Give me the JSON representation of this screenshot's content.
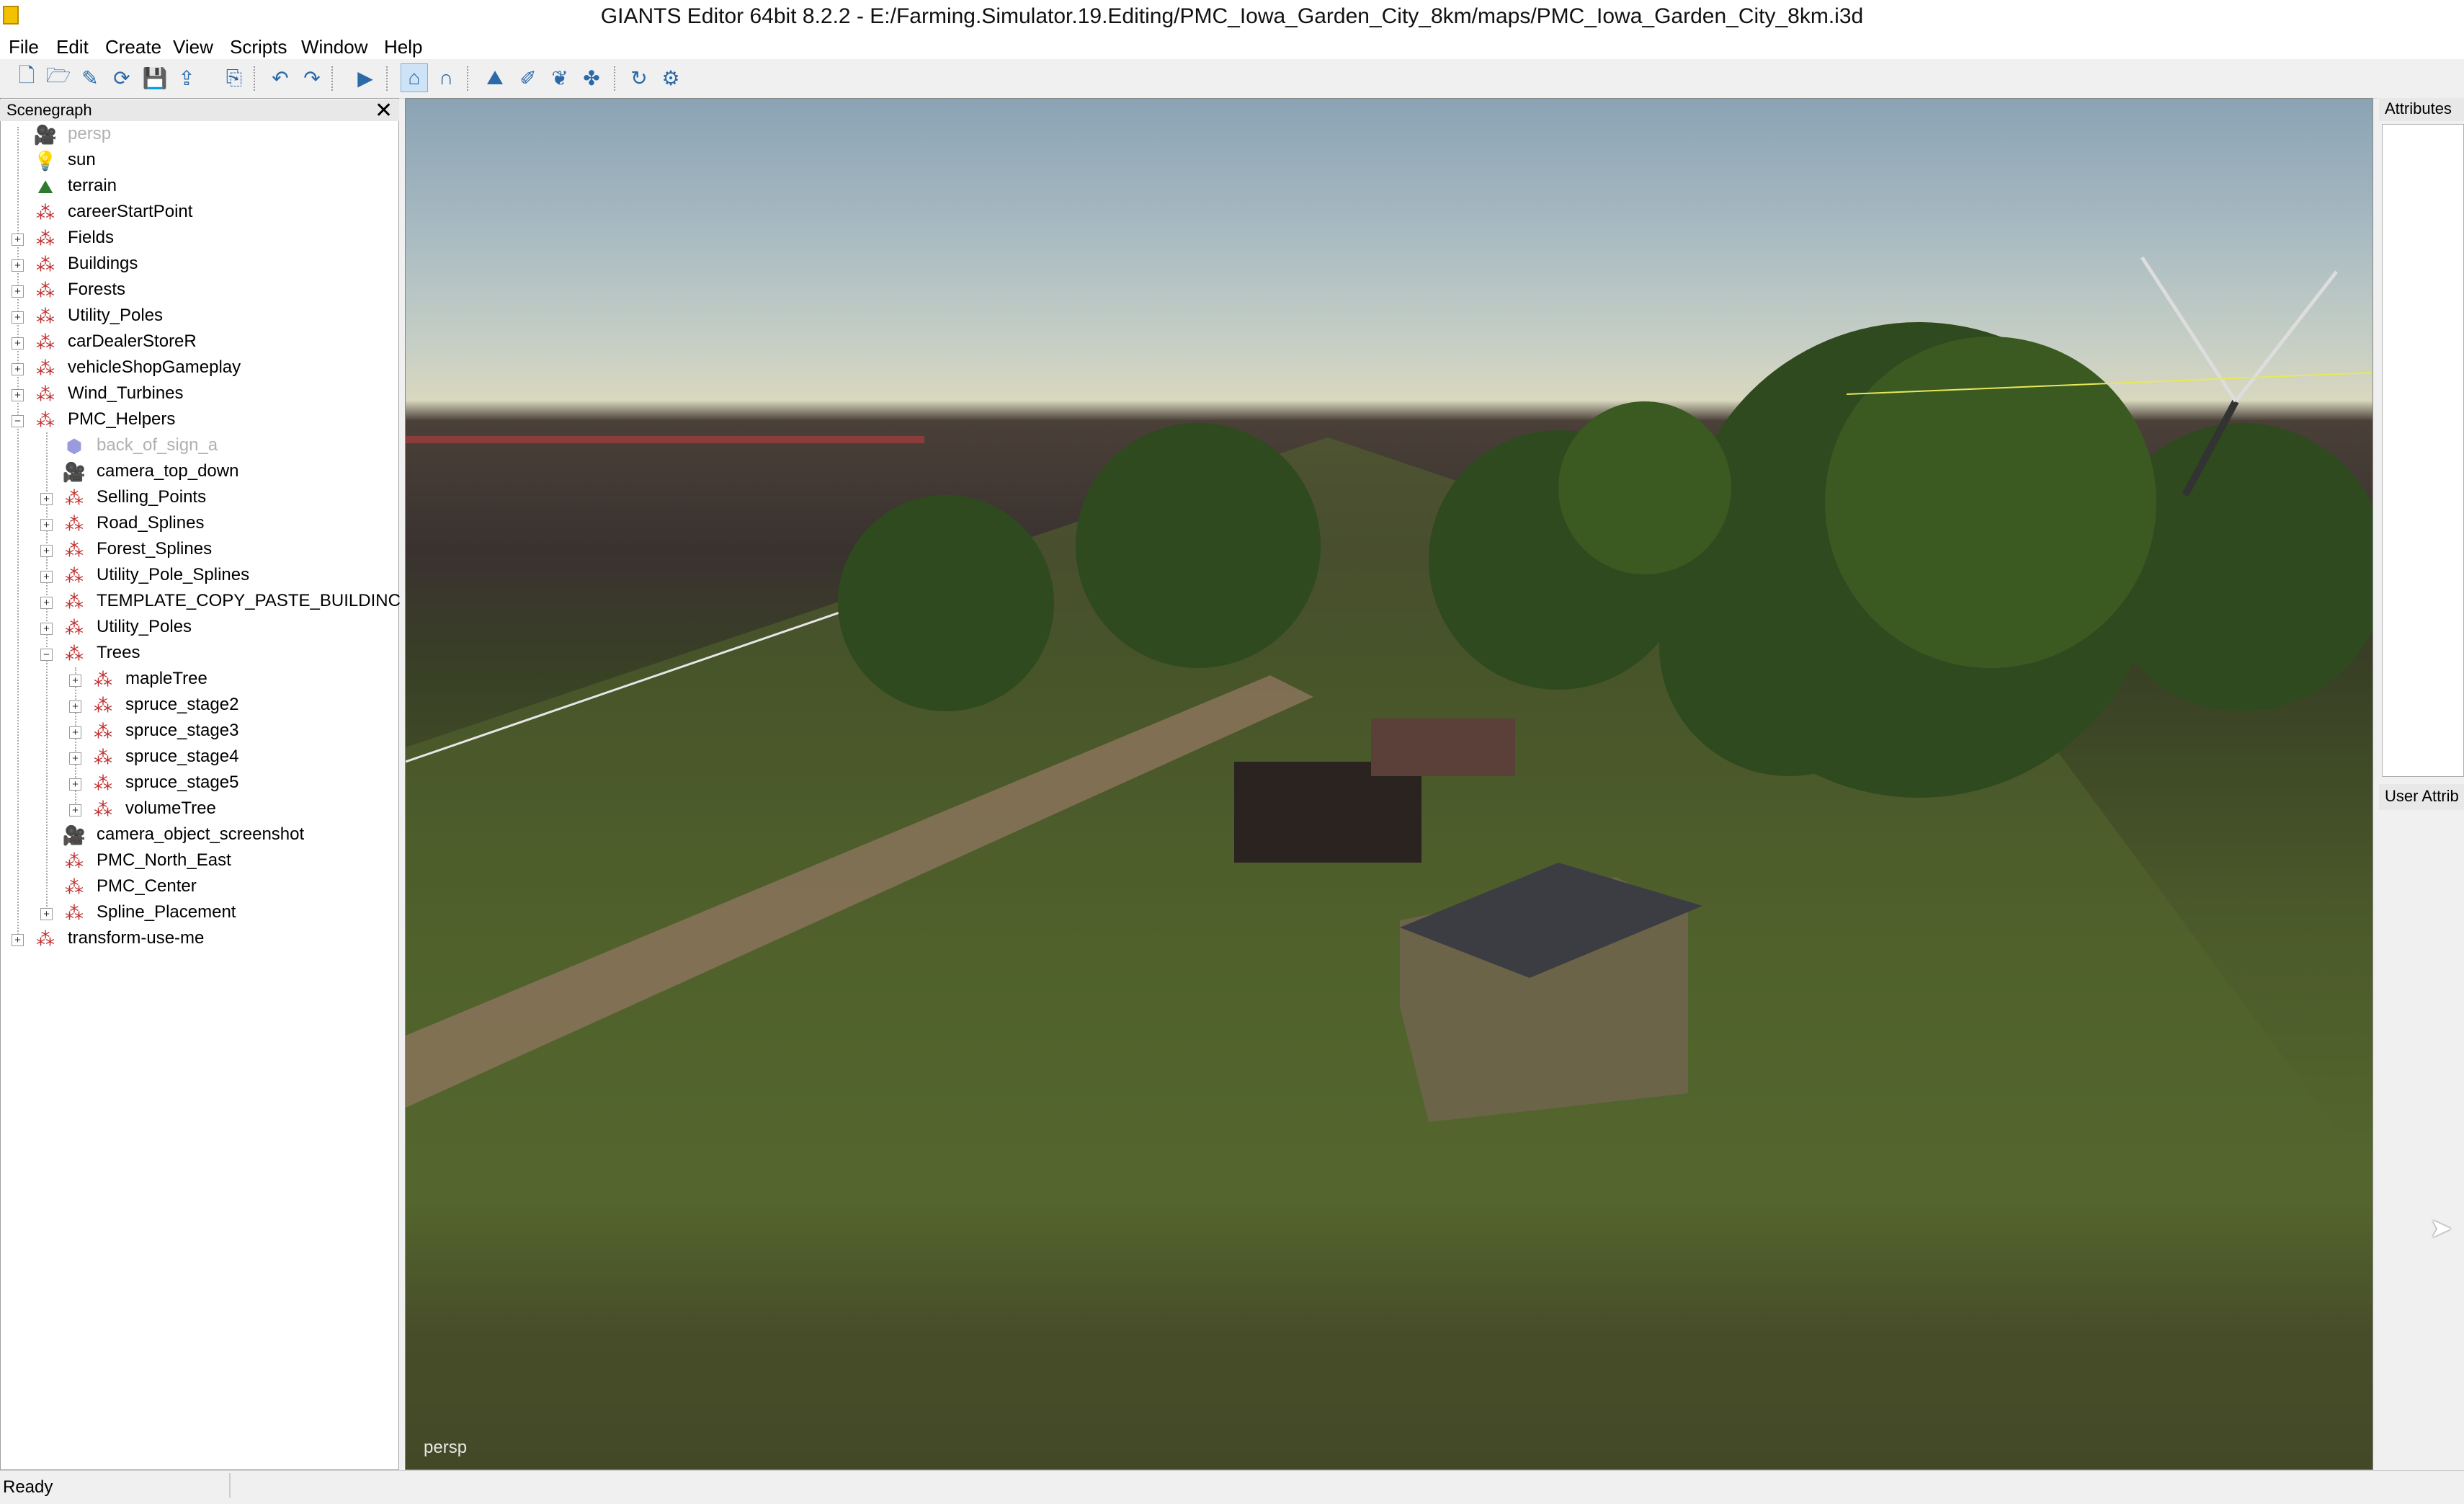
{
  "window": {
    "title": "GIANTS Editor 64bit 8.2.2 - E:/Farming.Simulator.19.Editing/PMC_Iowa_Garden_City_8km/maps/PMC_Iowa_Garden_City_8km.i3d"
  },
  "menu": [
    "File",
    "Edit",
    "Create",
    "View",
    "Scripts",
    "Window",
    "Help"
  ],
  "toolbar": [
    {
      "name": "new-icon",
      "glyph": "🗋"
    },
    {
      "name": "open-icon",
      "glyph": "🗁"
    },
    {
      "name": "edit-icon",
      "glyph": "✎"
    },
    {
      "name": "refresh-icon",
      "glyph": "⟳"
    },
    {
      "name": "save-icon",
      "glyph": "💾"
    },
    {
      "name": "export-icon",
      "glyph": "⇪"
    },
    {
      "name": "import-icon",
      "glyph": "⎘"
    },
    {
      "name": "undo-icon",
      "glyph": "↶"
    },
    {
      "name": "redo-icon",
      "glyph": "↷"
    },
    {
      "name": "play-icon",
      "glyph": "▶"
    },
    {
      "name": "select-mode-icon",
      "glyph": "⌂"
    },
    {
      "name": "move-mode-icon",
      "glyph": "∩"
    },
    {
      "name": "terrain-sculpt-icon",
      "glyph": "⛰"
    },
    {
      "name": "terrain-paint-icon",
      "glyph": "✐"
    },
    {
      "name": "foliage-paint-icon",
      "glyph": "❦"
    },
    {
      "name": "placement-icon",
      "glyph": "✤"
    },
    {
      "name": "rotate-icon",
      "glyph": "↻"
    },
    {
      "name": "settings-icon",
      "glyph": "⚙"
    }
  ],
  "scenegraph": {
    "title": "Scenegraph",
    "close": "✕",
    "nodes": [
      {
        "label": "persp",
        "icon": "camera-icon",
        "glyph": "🎥",
        "depth": 0,
        "exp": "",
        "dim": true
      },
      {
        "label": "sun",
        "icon": "light-icon",
        "glyph": "💡",
        "depth": 0,
        "exp": ""
      },
      {
        "label": "terrain",
        "icon": "terrain-icon",
        "glyph": "⛰",
        "depth": 0,
        "exp": ""
      },
      {
        "label": "careerStartPoint",
        "icon": "transform-icon",
        "glyph": "⁂",
        "depth": 0,
        "exp": ""
      },
      {
        "label": "Fields",
        "icon": "transform-icon",
        "glyph": "⁂",
        "depth": 0,
        "exp": "+"
      },
      {
        "label": "Buildings",
        "icon": "transform-icon",
        "glyph": "⁂",
        "depth": 0,
        "exp": "+"
      },
      {
        "label": "Forests",
        "icon": "transform-icon",
        "glyph": "⁂",
        "depth": 0,
        "exp": "+"
      },
      {
        "label": "Utility_Poles",
        "icon": "transform-icon",
        "glyph": "⁂",
        "depth": 0,
        "exp": "+"
      },
      {
        "label": "carDealerStoreR",
        "icon": "transform-icon",
        "glyph": "⁂",
        "depth": 0,
        "exp": "+"
      },
      {
        "label": "vehicleShopGameplay",
        "icon": "transform-icon",
        "glyph": "⁂",
        "depth": 0,
        "exp": "+"
      },
      {
        "label": "Wind_Turbines",
        "icon": "transform-icon",
        "glyph": "⁂",
        "depth": 0,
        "exp": "+"
      },
      {
        "label": "PMC_Helpers",
        "icon": "transform-icon",
        "glyph": "⁂",
        "depth": 0,
        "exp": "−"
      },
      {
        "label": "back_of_sign_a",
        "icon": "shape-icon",
        "glyph": "⬢",
        "depth": 1,
        "exp": "",
        "dim": true
      },
      {
        "label": "camera_top_down",
        "icon": "camera-icon",
        "glyph": "🎥",
        "depth": 1,
        "exp": ""
      },
      {
        "label": "Selling_Points",
        "icon": "transform-icon",
        "glyph": "⁂",
        "depth": 1,
        "exp": "+"
      },
      {
        "label": "Road_Splines",
        "icon": "transform-icon",
        "glyph": "⁂",
        "depth": 1,
        "exp": "+"
      },
      {
        "label": "Forest_Splines",
        "icon": "transform-icon",
        "glyph": "⁂",
        "depth": 1,
        "exp": "+"
      },
      {
        "label": "Utility_Pole_Splines",
        "icon": "transform-icon",
        "glyph": "⁂",
        "depth": 1,
        "exp": "+"
      },
      {
        "label": "TEMPLATE_COPY_PASTE_BUILDINC",
        "icon": "transform-icon",
        "glyph": "⁂",
        "depth": 1,
        "exp": "+"
      },
      {
        "label": "Utility_Poles",
        "icon": "transform-icon",
        "glyph": "⁂",
        "depth": 1,
        "exp": "+"
      },
      {
        "label": "Trees",
        "icon": "transform-icon",
        "glyph": "⁂",
        "depth": 1,
        "exp": "−"
      },
      {
        "label": "mapleTree",
        "icon": "transform-icon",
        "glyph": "⁂",
        "depth": 2,
        "exp": "+"
      },
      {
        "label": "spruce_stage2",
        "icon": "transform-icon",
        "glyph": "⁂",
        "depth": 2,
        "exp": "+"
      },
      {
        "label": "spruce_stage3",
        "icon": "transform-icon",
        "glyph": "⁂",
        "depth": 2,
        "exp": "+"
      },
      {
        "label": "spruce_stage4",
        "icon": "transform-icon",
        "glyph": "⁂",
        "depth": 2,
        "exp": "+"
      },
      {
        "label": "spruce_stage5",
        "icon": "transform-icon",
        "glyph": "⁂",
        "depth": 2,
        "exp": "+"
      },
      {
        "label": "volumeTree",
        "icon": "transform-icon",
        "glyph": "⁂",
        "depth": 2,
        "exp": "+"
      },
      {
        "label": "camera_object_screenshot",
        "icon": "camera-icon",
        "glyph": "🎥",
        "depth": 1,
        "exp": ""
      },
      {
        "label": "PMC_North_East",
        "icon": "transform-icon",
        "glyph": "⁂",
        "depth": 1,
        "exp": ""
      },
      {
        "label": "PMC_Center",
        "icon": "transform-icon",
        "glyph": "⁂",
        "depth": 1,
        "exp": ""
      },
      {
        "label": "Spline_Placement",
        "icon": "transform-icon",
        "glyph": "⁂",
        "depth": 1,
        "exp": "+"
      },
      {
        "label": "transform-use-me",
        "icon": "transform-icon",
        "glyph": "⁂",
        "depth": 0,
        "exp": "+"
      }
    ]
  },
  "viewport": {
    "camera_label": "persp"
  },
  "right_panel": {
    "attributes_label": "Attributes",
    "user_attributes_label": "User Attrib"
  },
  "status": {
    "text": "Ready"
  }
}
